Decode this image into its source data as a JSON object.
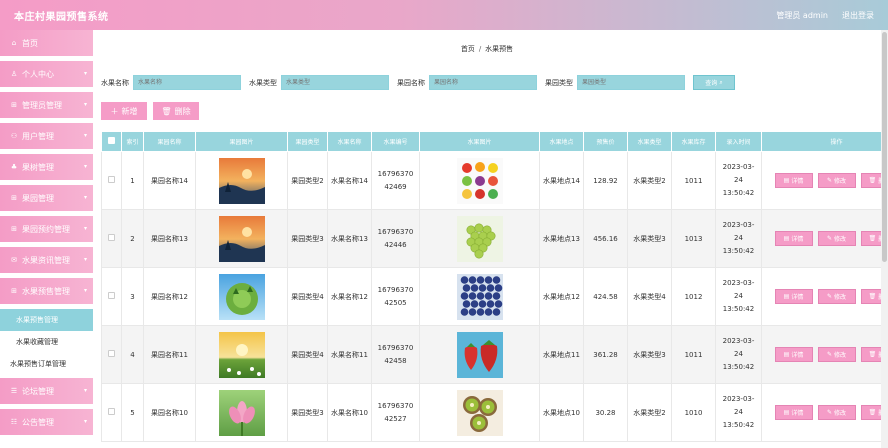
{
  "header": {
    "title": "本庄村果园预售系统",
    "role": "管理员 admin",
    "logout": "退出登录"
  },
  "sidebar": {
    "items": [
      {
        "label": "首页",
        "icon": "home-icon",
        "chev": false
      },
      {
        "label": "个人中心",
        "icon": "person-icon",
        "chev": true
      },
      {
        "label": "管理员管理",
        "icon": "grid-icon",
        "chev": true
      },
      {
        "label": "用户管理",
        "icon": "user-icon",
        "chev": true
      },
      {
        "label": "果树管理",
        "icon": "tree-icon",
        "chev": true
      },
      {
        "label": "果园管理",
        "icon": "grid-icon",
        "chev": true
      },
      {
        "label": "果园预约管理",
        "icon": "grid-icon",
        "chev": true
      },
      {
        "label": "水果资讯管理",
        "icon": "news-icon",
        "chev": true
      },
      {
        "label": "水果预售管理",
        "icon": "grid-icon",
        "chev": true
      }
    ],
    "sub_items": [
      {
        "label": "水果预售管理",
        "active": true
      },
      {
        "label": "水果收藏管理",
        "active": false
      },
      {
        "label": "水果预售订单管理",
        "active": false
      }
    ],
    "bottom_items": [
      {
        "label": "论坛管理",
        "icon": "forum-icon"
      },
      {
        "label": "公告管理",
        "icon": "notice-icon"
      }
    ]
  },
  "breadcrumb": {
    "home": "首页",
    "sep": "/",
    "current": "水果预售"
  },
  "search": {
    "fields": [
      {
        "label": "水果名称",
        "placeholder": "水果名称"
      },
      {
        "label": "水果类型",
        "placeholder": "水果类型"
      },
      {
        "label": "果园名称",
        "placeholder": "果园名称"
      },
      {
        "label": "果园类型",
        "placeholder": "果园类型"
      }
    ],
    "button": "查询"
  },
  "actions": {
    "add": "新增",
    "delete": "删除"
  },
  "table": {
    "headers": [
      "索引",
      "果园名称",
      "果园图片",
      "果园类型",
      "水果名称",
      "水果编号",
      "水果图片",
      "水果地点",
      "预售价",
      "水果类型",
      "水果库存",
      "录入时间",
      "操作"
    ],
    "rows": [
      {
        "idx": "1",
        "orchard": "果园名称14",
        "otype": "果园类型2",
        "fruit": "水果名称14",
        "code": "1679637042469",
        "place": "水果地点14",
        "price": "128.92",
        "ftype": "水果类型2",
        "stock": "1011",
        "time": "2023-03-24 13:50:42",
        "oimg": "sunset",
        "fimg": "mixed-fruit"
      },
      {
        "idx": "2",
        "orchard": "果园名称13",
        "otype": "果园类型3",
        "fruit": "水果名称13",
        "code": "1679637042446",
        "place": "水果地点13",
        "price": "456.16",
        "ftype": "水果类型3",
        "stock": "1013",
        "time": "2023-03-24 13:50:42",
        "oimg": "sunset",
        "fimg": "grapes"
      },
      {
        "idx": "3",
        "orchard": "果园名称12",
        "otype": "果园类型4",
        "fruit": "水果名称12",
        "code": "1679637042505",
        "place": "水果地点12",
        "price": "424.58",
        "ftype": "水果类型4",
        "stock": "1012",
        "time": "2023-03-24 13:50:42",
        "oimg": "planet",
        "fimg": "blueberries"
      },
      {
        "idx": "4",
        "orchard": "果园名称11",
        "otype": "果园类型4",
        "fruit": "水果名称11",
        "code": "1679637042458",
        "place": "水果地点11",
        "price": "361.28",
        "ftype": "水果类型3",
        "stock": "1011",
        "time": "2023-03-24 13:50:42",
        "oimg": "meadow",
        "fimg": "strawberries"
      },
      {
        "idx": "5",
        "orchard": "果园名称10",
        "otype": "果园类型3",
        "fruit": "水果名称10",
        "code": "1679637042527",
        "place": "水果地点10",
        "price": "30.28",
        "ftype": "水果类型2",
        "stock": "1010",
        "time": "2023-03-24 13:50:42",
        "oimg": "lotus",
        "fimg": "kiwi"
      }
    ],
    "ops": {
      "detail": "详情",
      "edit": "修改",
      "del": "删除"
    }
  },
  "colors": {
    "pink": "#f59cc7",
    "teal": "#98d5dd"
  }
}
